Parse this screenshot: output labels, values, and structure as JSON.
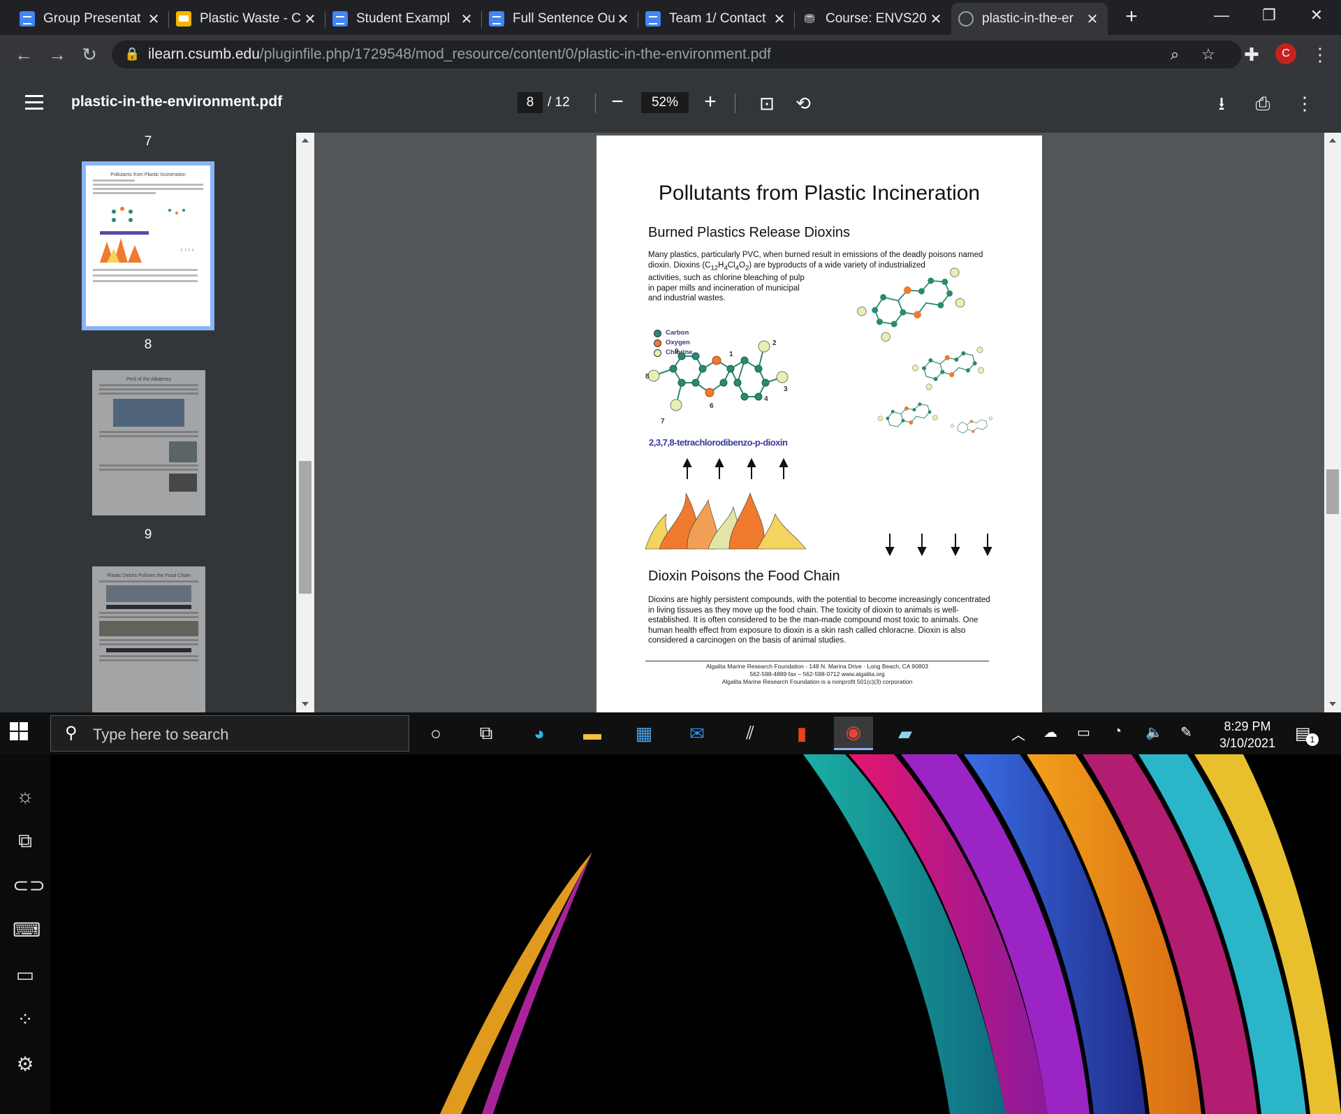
{
  "browser": {
    "tabs": [
      {
        "title": "Group Presentat",
        "icon": "docs-icon",
        "active": false
      },
      {
        "title": "Plastic Waste - C",
        "icon": "slides-icon",
        "active": false
      },
      {
        "title": "Student Exampl",
        "icon": "docs-icon",
        "active": false
      },
      {
        "title": "Full Sentence Ou",
        "icon": "docs-icon",
        "active": false
      },
      {
        "title": "Team 1/ Contact",
        "icon": "docs-icon",
        "active": false
      },
      {
        "title": "Course: ENVS20",
        "icon": "course-icon",
        "active": false
      },
      {
        "title": "plastic-in-the-er",
        "icon": "globe-icon",
        "active": true
      }
    ],
    "url_host": "ilearn.csumb.edu",
    "url_path": "/pluginfile.php/1729548/mod_resource/content/0/plastic-in-the-environment.pdf",
    "profile_initial": "C"
  },
  "viewer": {
    "filename": "plastic-in-the-environment.pdf",
    "current_page": "8",
    "total_pages": "/ 12",
    "zoom": "52%"
  },
  "sidebar": {
    "page_numbers": [
      "7",
      "8",
      "9"
    ],
    "thumb_titles": [
      "Pollutants from Plastic Incineration",
      "Peril of the Albatross",
      "Plastic Debris Pollutes the Food Chain"
    ],
    "selected_page": "8"
  },
  "document": {
    "title": "Pollutants from Plastic Incineration",
    "heading1": "Burned Plastics Release Dioxins",
    "para1_a": "Many plastics, particularly PVC, when burned result in emissions of the deadly poisons named dioxin.  Dioxins (C",
    "para1_sub1": "12",
    "para1_b": "H",
    "para1_sub2": "4",
    "para1_c": "Cl",
    "para1_sub3": "4",
    "para1_d": "O",
    "para1_sub4": "2",
    "para1_e": ") are byproducts of a wide variety of industrialized",
    "para1_f": "activities, such as chlorine bleaching of pulp in paper mills and incineration of municipal and industrial wastes.",
    "legend": [
      "Carbon",
      "Oxygen",
      "Chlorine"
    ],
    "molecule_name": "2,3,7,8-tetrachlorodibenzo-p-dioxin",
    "atom_numbers": [
      "1",
      "2",
      "3",
      "4",
      "6",
      "7",
      "8",
      "9"
    ],
    "heading2": "Dioxin Poisons the Food Chain",
    "para2": "Dioxins are highly persistent compounds, with the potential to become increasingly concentrated in living tissues as they move up the food chain.  The toxicity of dioxin to animals is well-established. It is often considered to be the man-made compound most toxic to animals. One human health effect from exposure to dioxin is a skin rash called chloracne.  Dioxin is also considered a carcinogen on the basis of animal studies.",
    "footer_line1": "Algalita Marine Research Foundation  -  148 N. Marina Drive · Long Beach, CA  90803",
    "footer_line2": "562-598-4889        fax – 562-598-0712        www.algalita.org",
    "footer_line3": "Algalita Marine Research Foundation is a nonprofit 501(c)(3) corporation"
  },
  "taskbar": {
    "search_placeholder": "Type here to search",
    "time": "8:29 PM",
    "date": "3/10/2021",
    "notification_count": "1"
  },
  "colors": {
    "carbon": "#2a8a6e",
    "oxygen": "#f07a2e",
    "chlorine": "#e9efb0",
    "selected_outline": "#8ab4f8"
  }
}
